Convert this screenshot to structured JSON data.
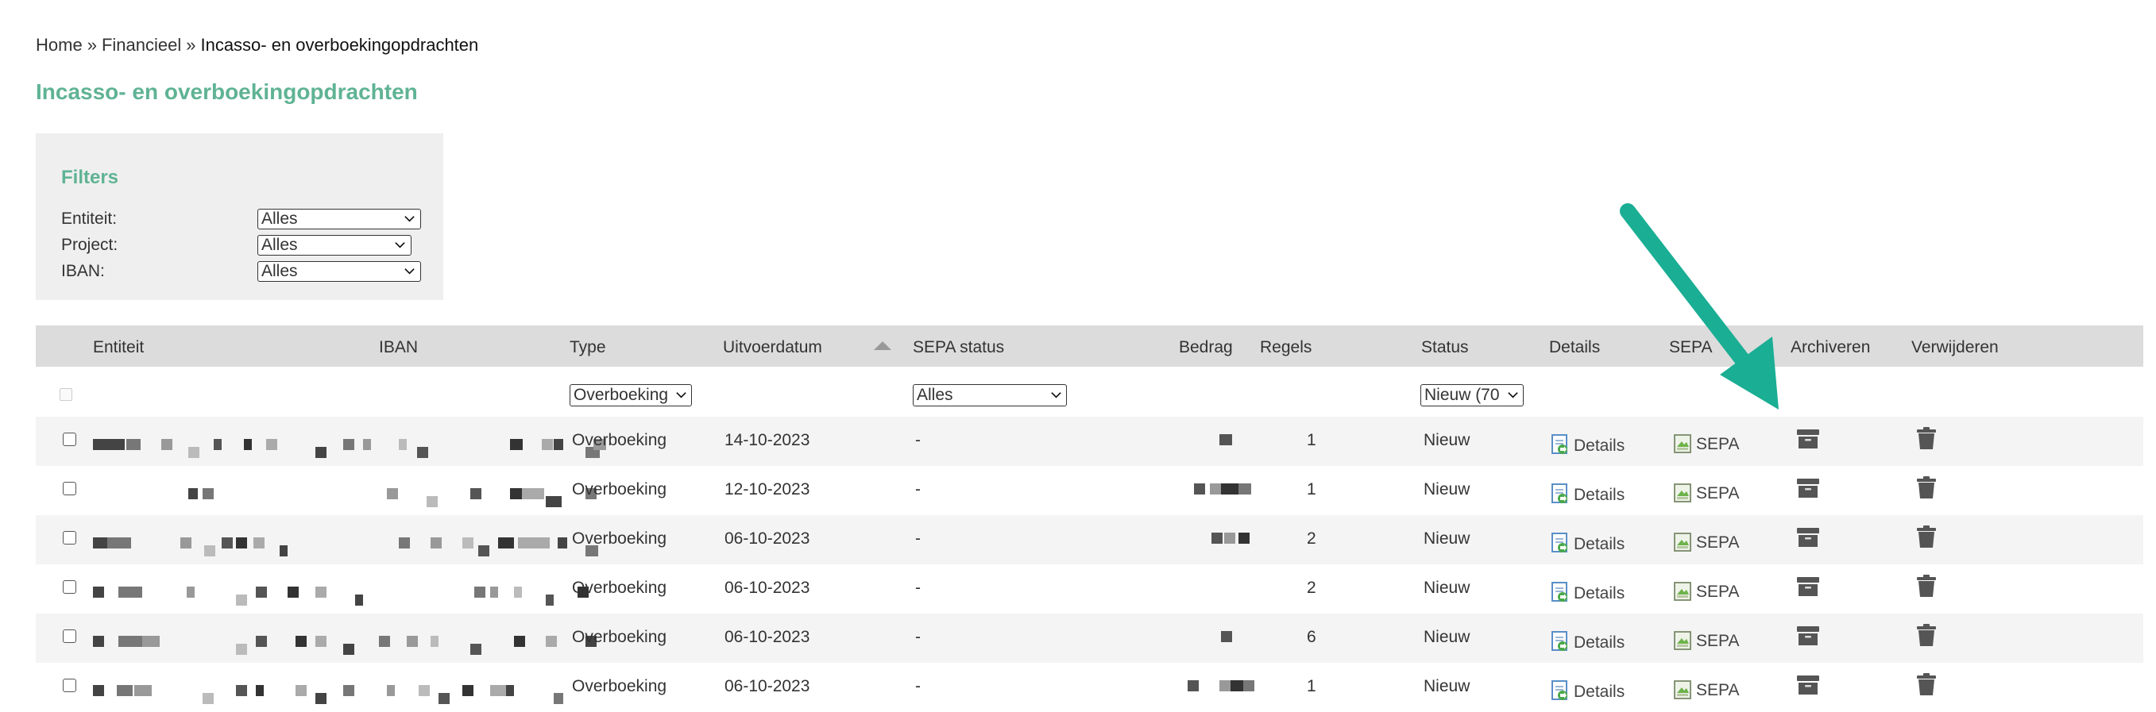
{
  "breadcrumb": {
    "home": "Home",
    "separator": "»",
    "financieel": "Financieel",
    "current": "Incasso- en overboekingopdrachten"
  },
  "page_title": "Incasso- en overboekingopdrachten",
  "filters": {
    "title": "Filters",
    "entiteit": {
      "label": "Entiteit:",
      "value": "Alles"
    },
    "project": {
      "label": "Project:",
      "value": "Alles"
    },
    "iban": {
      "label": "IBAN:",
      "value": "Alles"
    }
  },
  "table": {
    "headers": {
      "entiteit": "Entiteit",
      "iban": "IBAN",
      "type": "Type",
      "uitvoerdatum": "Uitvoerdatum",
      "sepa_status": "SEPA status",
      "bedrag": "Bedrag",
      "regels": "Regels",
      "status": "Status",
      "details": "Details",
      "sepa": "SEPA",
      "archiveren": "Archiveren",
      "verwijderen": "Verwijderen"
    },
    "column_filters": {
      "type": "Overboeking",
      "sepa_status": "Alles",
      "status": "Nieuw (70"
    },
    "rows": [
      {
        "type": "Overboeking",
        "date": "14-10-2023",
        "sepa_status": "-",
        "regels": "1",
        "status": "Nieuw",
        "details": "Details",
        "sepa": "SEPA"
      },
      {
        "type": "Overboeking",
        "date": "12-10-2023",
        "sepa_status": "-",
        "regels": "1",
        "status": "Nieuw",
        "details": "Details",
        "sepa": "SEPA"
      },
      {
        "type": "Overboeking",
        "date": "06-10-2023",
        "sepa_status": "-",
        "regels": "2",
        "status": "Nieuw",
        "details": "Details",
        "sepa": "SEPA"
      },
      {
        "type": "Overboeking",
        "date": "06-10-2023",
        "sepa_status": "-",
        "regels": "2",
        "status": "Nieuw",
        "details": "Details",
        "sepa": "SEPA"
      },
      {
        "type": "Overboeking",
        "date": "06-10-2023",
        "sepa_status": "-",
        "regels": "6",
        "status": "Nieuw",
        "details": "Details",
        "sepa": "SEPA"
      },
      {
        "type": "Overboeking",
        "date": "06-10-2023",
        "sepa_status": "-",
        "regels": "1",
        "status": "Nieuw",
        "details": "Details",
        "sepa": "SEPA"
      }
    ]
  },
  "colors": {
    "accent": "#5fb394",
    "arrow": "#1aae94",
    "header_bg": "#dcdcdc",
    "row_alt_bg": "#f4f4f4",
    "filters_bg": "#efefef"
  },
  "icons": {
    "sort": "sort-asc-icon",
    "details": "document-edit-icon",
    "sepa": "sepa-document-icon",
    "archive": "archive-box-icon",
    "delete": "trash-icon",
    "annotation": "arrow-annotation"
  }
}
